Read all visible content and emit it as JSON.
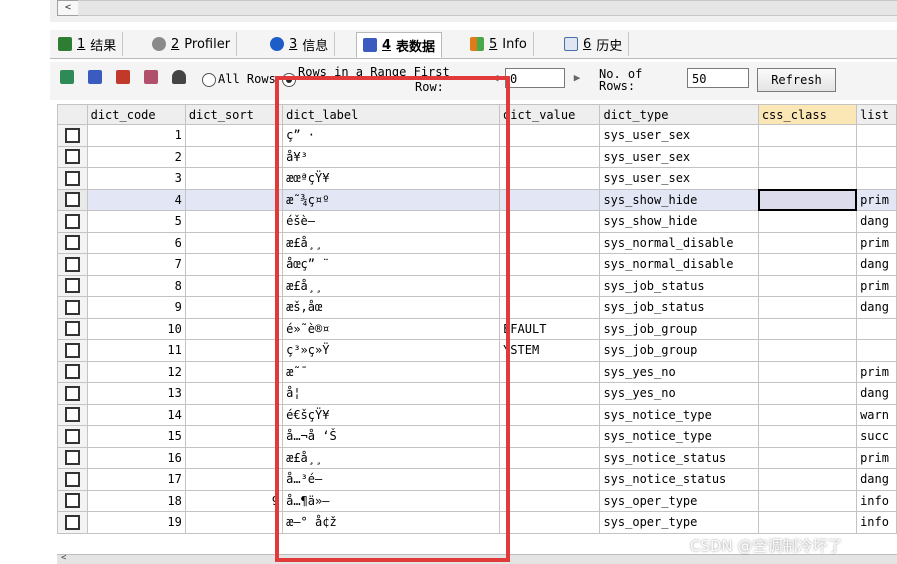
{
  "tabs": [
    {
      "num": "1",
      "label": "结果",
      "icon": "result-icon",
      "color": "#2e7d32"
    },
    {
      "num": "2",
      "label": "Profiler",
      "icon": "profiler-icon",
      "color": "#6d6d6d"
    },
    {
      "num": "3",
      "label": "信息",
      "icon": "info-icon",
      "color": "#1e5cc8"
    },
    {
      "num": "4",
      "label": "表数据",
      "icon": "table-data-icon",
      "color": "#3a5bbf"
    },
    {
      "num": "5",
      "label": "Info",
      "icon": "info-chart-icon",
      "color": "#e07b1a"
    },
    {
      "num": "6",
      "label": "历史",
      "icon": "history-icon",
      "color": "#4a6fa5"
    }
  ],
  "toolbar": {
    "all_rows_label": "All Rows",
    "range_label": "Rows in a Range First",
    "row_label": "Row:",
    "first_row_value": "0",
    "no_of_rows_label": "No. of Rows:",
    "rows_value": "50",
    "refresh_label": "Refresh"
  },
  "grid": {
    "columns": [
      "dict_code",
      "dict_sort",
      "dict_label",
      "dict_value",
      "dict_type",
      "css_class",
      "list"
    ],
    "rows": [
      {
        "code": "1",
        "sort": "",
        "label": "ç” ·",
        "value": "",
        "type": "sys_user_sex",
        "css": "",
        "list": ""
      },
      {
        "code": "2",
        "sort": "",
        "label": "å¥³",
        "value": "",
        "type": "sys_user_sex",
        "css": "",
        "list": ""
      },
      {
        "code": "3",
        "sort": "",
        "label": "æœªçŸ¥",
        "value": "",
        "type": "sys_user_sex",
        "css": "",
        "list": ""
      },
      {
        "code": "4",
        "sort": "",
        "label": "æ˜¾ç¤º",
        "value": "",
        "type": "sys_show_hide",
        "css": "",
        "list": "prim"
      },
      {
        "code": "5",
        "sort": "",
        "label": "éšè—",
        "value": "",
        "type": "sys_show_hide",
        "css": "",
        "list": "dang"
      },
      {
        "code": "6",
        "sort": "",
        "label": "æ­£å¸¸",
        "value": "",
        "type": "sys_normal_disable",
        "css": "",
        "list": "prim"
      },
      {
        "code": "7",
        "sort": "",
        "label": "åœç” ¨",
        "value": "",
        "type": "sys_normal_disable",
        "css": "",
        "list": "dang"
      },
      {
        "code": "8",
        "sort": "",
        "label": "æ­£å¸¸",
        "value": "",
        "type": "sys_job_status",
        "css": "",
        "list": "prim"
      },
      {
        "code": "9",
        "sort": "",
        "label": "æš‚åœ",
        "value": "",
        "type": "sys_job_status",
        "css": "",
        "list": "dang"
      },
      {
        "code": "10",
        "sort": "",
        "label": "é»˜è®¤",
        "value": "EFAULT",
        "type": "sys_job_group",
        "css": "",
        "list": ""
      },
      {
        "code": "11",
        "sort": "",
        "label": "ç³»ç»Ÿ",
        "value": "YSTEM",
        "type": "sys_job_group",
        "css": "",
        "list": ""
      },
      {
        "code": "12",
        "sort": "",
        "label": "æ˜¯",
        "value": "",
        "type": "sys_yes_no",
        "css": "",
        "list": "prim"
      },
      {
        "code": "13",
        "sort": "",
        "label": "å¦",
        "value": "",
        "type": "sys_yes_no",
        "css": "",
        "list": "dang"
      },
      {
        "code": "14",
        "sort": "",
        "label": "é€šçŸ¥",
        "value": "",
        "type": "sys_notice_type",
        "css": "",
        "list": "warn"
      },
      {
        "code": "15",
        "sort": "",
        "label": "å…¬å ‘Š",
        "value": "",
        "type": "sys_notice_type",
        "css": "",
        "list": "succ"
      },
      {
        "code": "16",
        "sort": "",
        "label": "æ­£å¸¸",
        "value": "",
        "type": "sys_notice_status",
        "css": "",
        "list": "prim"
      },
      {
        "code": "17",
        "sort": "",
        "label": "å…³é—­",
        "value": "",
        "type": "sys_notice_status",
        "css": "",
        "list": "dang"
      },
      {
        "code": "18",
        "sort": "9",
        "label": "å…¶ä»–",
        "value": "",
        "type": "sys_oper_type",
        "css": "",
        "list": "info"
      },
      {
        "code": "19",
        "sort": "",
        "label": "æ–° å¢ž",
        "value": "",
        "type": "sys_oper_type",
        "css": "",
        "list": "info"
      }
    ]
  },
  "watermark": "CSDN @空调制冷坏了",
  "colors": {
    "highlight_box": "#e03a3a",
    "selected_row": "#e3e6f4",
    "selected_header": "#fbe6b5"
  }
}
